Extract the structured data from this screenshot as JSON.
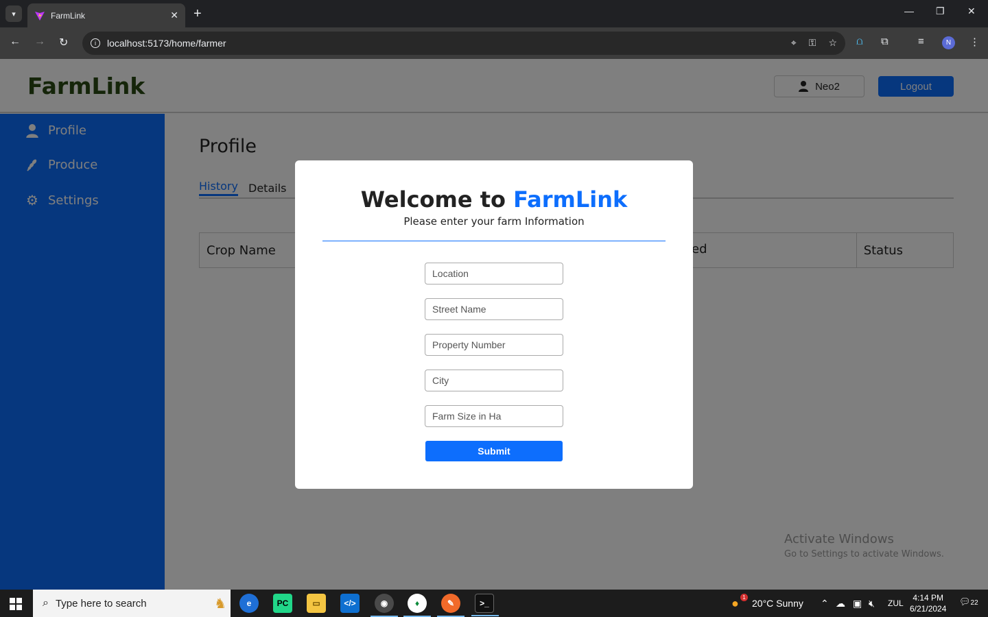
{
  "browser": {
    "tab_title": "FarmLink",
    "url": "localhost:5173/home/farmer",
    "tab_close": "✕",
    "new_tab": "+",
    "profile_initial": "N"
  },
  "app": {
    "brand": "FarmLink",
    "user_name": "Neo2",
    "logout_label": "Logout",
    "sidebar": [
      {
        "label": "Profile",
        "icon": "user-icon"
      },
      {
        "label": "Produce",
        "icon": "wheat-icon"
      },
      {
        "label": "Settings",
        "icon": "gear-icon"
      }
    ],
    "page_title": "Profile",
    "tabs": [
      "History",
      "Details"
    ],
    "table_headers": [
      "Crop Name",
      "ed",
      "Status"
    ]
  },
  "modal": {
    "title_prefix": "Welcome to ",
    "title_accent": "FarmLink",
    "subtitle": "Please enter your farm Information",
    "fields": [
      {
        "placeholder": "Location"
      },
      {
        "placeholder": "Street Name"
      },
      {
        "placeholder": "Property Number"
      },
      {
        "placeholder": "City"
      },
      {
        "placeholder": "Farm Size in Ha"
      }
    ],
    "submit_label": "Submit"
  },
  "watermark": {
    "line1": "Activate Windows",
    "line2": "Go to Settings to activate Windows."
  },
  "taskbar": {
    "search_placeholder": "Type here to search",
    "weather": "20°C  Sunny",
    "weather_badge": "1",
    "language": "ZUL",
    "time": "4:14 PM",
    "date": "6/21/2024",
    "notification_count": "22"
  },
  "colors": {
    "accent": "#0d6efd",
    "brand_text": "#2b4a14"
  }
}
